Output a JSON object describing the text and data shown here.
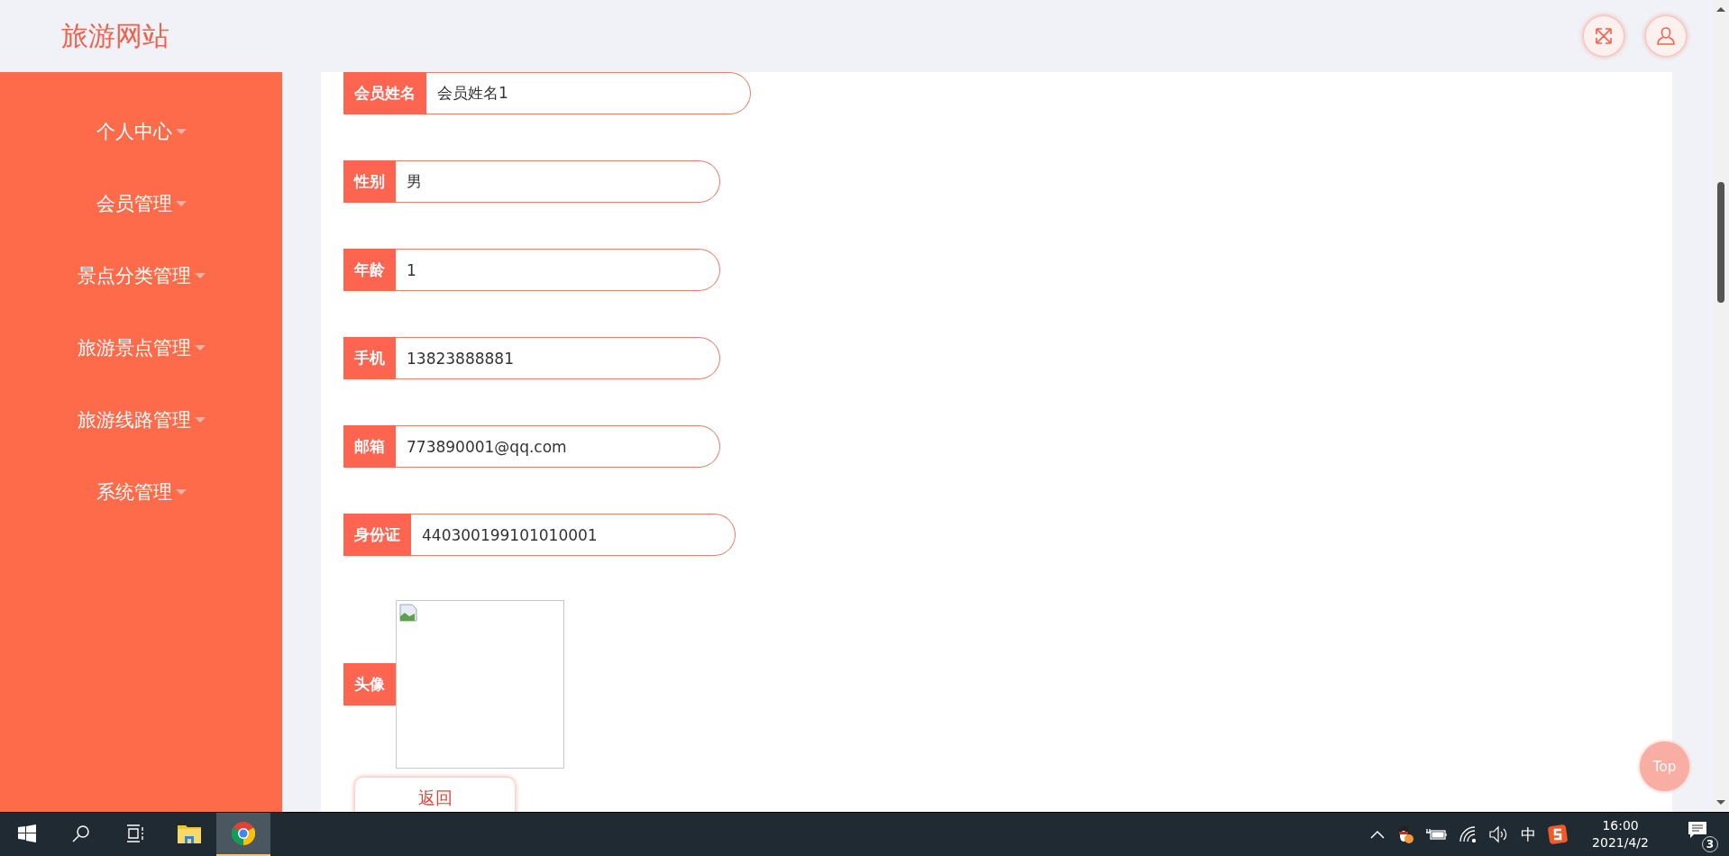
{
  "header": {
    "title": "旅游网站"
  },
  "sidebar": {
    "items": [
      {
        "label": "个人中心"
      },
      {
        "label": "会员管理"
      },
      {
        "label": "景点分类管理"
      },
      {
        "label": "旅游景点管理"
      },
      {
        "label": "旅游线路管理"
      },
      {
        "label": "系统管理"
      }
    ]
  },
  "form": {
    "fields": [
      {
        "label": "会员姓名",
        "value": "会员姓名1"
      },
      {
        "label": "性别",
        "value": "男"
      },
      {
        "label": "年龄",
        "value": "1"
      },
      {
        "label": "手机",
        "value": "13823888881"
      },
      {
        "label": "邮箱",
        "value": "773890001@qq.com"
      },
      {
        "label": "身份证",
        "value": "440300199101010001"
      }
    ],
    "avatar": {
      "label": "头像"
    },
    "back_button": "返回"
  },
  "top_button": "Top",
  "taskbar": {
    "pinned": [
      {
        "selected": false
      },
      {
        "selected": false
      },
      {
        "selected": false
      },
      {
        "selected": false
      },
      {
        "selected": true
      }
    ],
    "ime": "中",
    "time": "16:00",
    "date": "2021/4/2",
    "notifications": "3"
  }
}
